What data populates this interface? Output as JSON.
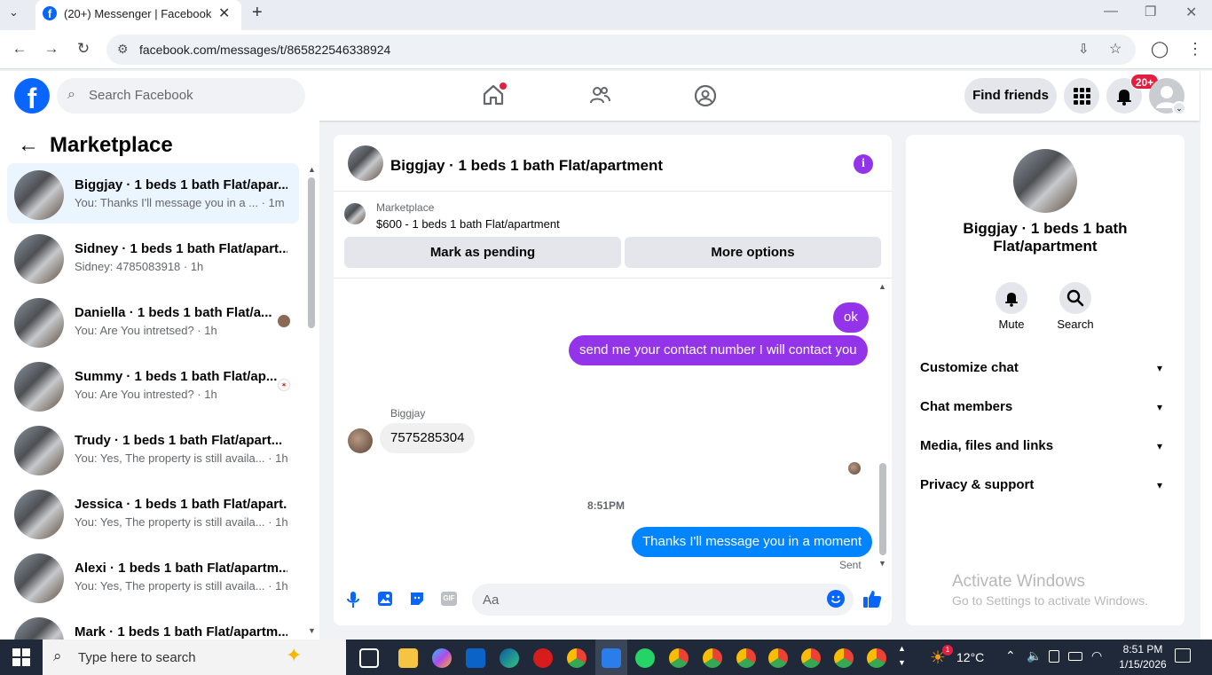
{
  "browser": {
    "tab_title": "(20+) Messenger | Facebook",
    "url": "facebook.com/messages/t/865822546338924"
  },
  "header": {
    "search_placeholder": "Search Facebook",
    "find_friends": "Find friends",
    "notif_badge": "20+"
  },
  "sidebar": {
    "title": "Marketplace",
    "items": [
      {
        "name": "Biggjay · 1 beds 1 bath Flat/apar...",
        "preview": "You: Thanks I'll message you in a ... · 1m"
      },
      {
        "name": "Sidney · 1 beds 1 bath Flat/apart...",
        "preview": "Sidney: 4785083918 · 1h"
      },
      {
        "name": "Daniella · 1 beds 1 bath Flat/a...",
        "preview": "You: Are You intretsed? · 1h"
      },
      {
        "name": "Summy · 1 beds 1 bath Flat/ap...",
        "preview": "You: Are You intrested? · 1h"
      },
      {
        "name": "Trudy · 1 beds 1 bath Flat/apart...",
        "preview": "You: Yes, The property is still availa... · 1h"
      },
      {
        "name": "Jessica · 1 beds 1 bath Flat/apart...",
        "preview": "You: Yes, The property is still availa... · 1h"
      },
      {
        "name": "Alexi · 1 beds 1 bath Flat/apartm...",
        "preview": "You: Yes, The property is still availa... · 1h"
      },
      {
        "name": "Mark · 1 beds 1 bath Flat/apartm...",
        "preview": ""
      }
    ]
  },
  "chat": {
    "title": "Biggjay · 1 beds 1 bath Flat/apartment",
    "listing_label": "Marketplace",
    "listing_desc": "$600 - 1 beds 1 bath Flat/apartment",
    "mark_pending": "Mark as pending",
    "more_options": "More options",
    "messages": [
      {
        "text": "ok"
      },
      {
        "text": "send me your contact number I will contact you"
      },
      {
        "sender": "Biggjay",
        "text": "7575285304"
      },
      {
        "text": "Thanks I'll message you in a moment"
      }
    ],
    "time_divider": "8:51PM",
    "status": "Sent",
    "composer_placeholder": "Aa",
    "gif_label": "GIF"
  },
  "info": {
    "name": "Biggjay · 1 beds 1 bath Flat/apartment",
    "mute": "Mute",
    "search": "Search",
    "sections": [
      "Customize chat",
      "Chat members",
      "Media, files and links",
      "Privacy & support"
    ]
  },
  "watermark": {
    "line1": "Activate Windows",
    "line2": "Go to Settings to activate Windows."
  },
  "taskbar": {
    "search_placeholder": "Type here to search",
    "temp": "12°C",
    "time": "8:51 PM",
    "date": "1/15/2026",
    "weather_badge": "1"
  },
  "colors": {
    "fb_blue": "#0866ff",
    "messenger_blue": "#0084ff",
    "purple": "#9333ea",
    "taskbar": "#202939"
  }
}
